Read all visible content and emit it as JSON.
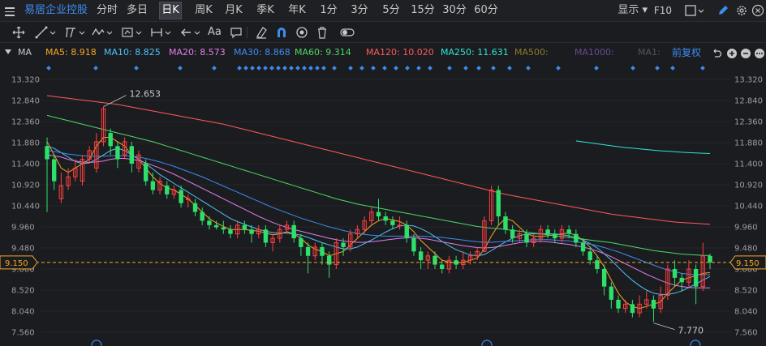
{
  "topbar": {
    "stock_name": "易居企业控股",
    "periods": [
      "分时",
      "多日",
      "日K",
      "周K",
      "月K",
      "季K",
      "年K",
      "1分",
      "3分",
      "5分",
      "15分",
      "30分",
      "60分"
    ],
    "active_period": "日K",
    "display_label": "显示",
    "f10_label": "F10"
  },
  "toolbar": {
    "font_label": "Aa"
  },
  "ma_legend": {
    "label": "MA",
    "items": [
      {
        "text": "MA5: 8.918",
        "color": "#f5a623"
      },
      {
        "text": "MA10: 8.825",
        "color": "#4fc3f7"
      },
      {
        "text": "MA20: 8.573",
        "color": "#e07ee8"
      },
      {
        "text": "MA30: 8.868",
        "color": "#3d8cf0"
      },
      {
        "text": "MA60: 9.314",
        "color": "#4cd964"
      },
      {
        "text": "MA120: 10.020",
        "color": "#ff5a5a"
      },
      {
        "text": "MA250: 11.631",
        "color": "#2ee6d6"
      },
      {
        "text": "MA500:",
        "color": "#8a7a2a"
      },
      {
        "text": "MA1000:",
        "color": "#6a4a8a"
      },
      {
        "text": "MA1:",
        "color": "#555555"
      }
    ],
    "restore_label": "前复权"
  },
  "chart_data": {
    "type": "candlestick",
    "y_ticks": [
      "13.320",
      "12.840",
      "12.360",
      "11.880",
      "11.400",
      "10.920",
      "10.440",
      "9.960",
      "9.480",
      "9.000",
      "8.520",
      "8.040",
      "7.560"
    ],
    "ylim": [
      7.56,
      13.32
    ],
    "current_price": "9.150",
    "high_label": "12.653",
    "low_label": "7.770",
    "up_color": "#ff4040",
    "down_color": "#2ee06a",
    "candles": [
      [
        11.8,
        11.5,
        12.0,
        10.3
      ],
      [
        11.5,
        11.0,
        11.6,
        10.8
      ],
      [
        10.6,
        10.9,
        11.2,
        10.5
      ],
      [
        10.9,
        11.1,
        11.3,
        10.8
      ],
      [
        11.1,
        11.3,
        11.5,
        11.0
      ],
      [
        11.0,
        11.5,
        11.6,
        10.9
      ],
      [
        11.5,
        11.7,
        11.8,
        11.4
      ],
      [
        11.3,
        11.9,
        12.1,
        11.2
      ],
      [
        11.9,
        12.65,
        12.7,
        11.8
      ],
      [
        12.1,
        11.8,
        12.2,
        11.6
      ],
      [
        11.8,
        11.5,
        11.9,
        11.3
      ],
      [
        11.6,
        11.9,
        12.0,
        11.5
      ],
      [
        11.8,
        11.4,
        11.9,
        11.2
      ],
      [
        11.3,
        11.6,
        11.7,
        11.2
      ],
      [
        11.4,
        11.0,
        11.5,
        10.9
      ],
      [
        11.0,
        10.8,
        11.2,
        10.7
      ],
      [
        10.8,
        11.0,
        11.1,
        10.7
      ],
      [
        10.9,
        10.7,
        11.0,
        10.6
      ],
      [
        10.7,
        10.8,
        10.9,
        10.6
      ],
      [
        10.8,
        10.5,
        10.9,
        10.4
      ],
      [
        10.6,
        10.6,
        10.7,
        10.4
      ],
      [
        10.5,
        10.3,
        10.6,
        10.2
      ],
      [
        10.3,
        10.1,
        10.4,
        10.0
      ],
      [
        10.1,
        10.0,
        10.2,
        9.9
      ],
      [
        10.0,
        9.95,
        10.1,
        9.9
      ],
      [
        9.95,
        9.9,
        10.1,
        9.8
      ],
      [
        9.9,
        9.8,
        10.0,
        9.7
      ],
      [
        9.8,
        10.0,
        10.1,
        9.7
      ],
      [
        10.0,
        9.9,
        10.1,
        9.8
      ],
      [
        9.9,
        9.8,
        10.0,
        9.6
      ],
      [
        9.8,
        9.9,
        10.0,
        9.7
      ],
      [
        9.9,
        9.6,
        10.0,
        9.5
      ],
      [
        9.6,
        9.7,
        9.8,
        9.4
      ],
      [
        9.7,
        9.9,
        10.0,
        9.6
      ],
      [
        9.9,
        10.0,
        10.1,
        9.8
      ],
      [
        10.0,
        9.7,
        10.1,
        9.6
      ],
      [
        9.7,
        9.5,
        9.8,
        9.3
      ],
      [
        9.5,
        9.3,
        9.6,
        8.9
      ],
      [
        9.3,
        9.5,
        9.6,
        9.2
      ],
      [
        9.5,
        9.3,
        9.6,
        9.1
      ],
      [
        9.3,
        9.1,
        9.4,
        8.8
      ],
      [
        9.1,
        9.6,
        9.7,
        9.0
      ],
      [
        9.6,
        9.5,
        9.7,
        9.3
      ],
      [
        9.5,
        9.8,
        9.9,
        9.4
      ],
      [
        9.8,
        9.9,
        10.0,
        9.7
      ],
      [
        9.9,
        10.1,
        10.2,
        9.8
      ],
      [
        10.1,
        10.3,
        10.4,
        10.0
      ],
      [
        10.3,
        10.2,
        10.6,
        10.1
      ],
      [
        10.2,
        10.1,
        10.3,
        10.0
      ],
      [
        10.1,
        10.0,
        10.2,
        9.9
      ],
      [
        10.0,
        10.0,
        10.2,
        9.9
      ],
      [
        10.0,
        9.7,
        10.1,
        9.6
      ],
      [
        9.7,
        9.4,
        9.8,
        9.3
      ],
      [
        9.4,
        9.2,
        9.5,
        9.0
      ],
      [
        9.2,
        9.3,
        9.4,
        9.0
      ],
      [
        9.3,
        9.1,
        9.4,
        9.0
      ],
      [
        9.1,
        9.0,
        9.2,
        8.9
      ],
      [
        9.0,
        9.2,
        9.3,
        8.9
      ],
      [
        9.2,
        9.1,
        9.3,
        9.0
      ],
      [
        9.1,
        9.2,
        9.4,
        9.0
      ],
      [
        9.2,
        9.3,
        9.4,
        9.1
      ],
      [
        9.3,
        9.4,
        9.5,
        9.2
      ],
      [
        9.4,
        10.1,
        10.2,
        9.4
      ],
      [
        10.1,
        10.8,
        10.9,
        10.0
      ],
      [
        10.8,
        10.2,
        10.9,
        10.0
      ],
      [
        10.2,
        9.9,
        10.3,
        9.8
      ],
      [
        9.9,
        9.7,
        10.0,
        9.6
      ],
      [
        9.7,
        9.8,
        9.9,
        9.6
      ],
      [
        9.8,
        9.6,
        9.9,
        9.5
      ],
      [
        9.6,
        9.7,
        9.8,
        9.5
      ],
      [
        9.7,
        9.9,
        10.0,
        9.6
      ],
      [
        9.9,
        9.8,
        10.0,
        9.7
      ],
      [
        9.8,
        9.7,
        9.9,
        9.6
      ],
      [
        9.7,
        9.9,
        10.0,
        9.6
      ],
      [
        9.9,
        9.8,
        10.0,
        9.7
      ],
      [
        9.8,
        9.6,
        9.9,
        9.5
      ],
      [
        9.6,
        9.4,
        9.7,
        9.3
      ],
      [
        9.4,
        9.2,
        9.5,
        9.1
      ],
      [
        9.2,
        9.0,
        9.3,
        8.9
      ],
      [
        9.0,
        8.6,
        9.1,
        8.4
      ],
      [
        8.6,
        8.3,
        8.7,
        8.1
      ],
      [
        8.3,
        8.1,
        8.4,
        8.0
      ],
      [
        8.1,
        8.2,
        8.3,
        8.0
      ],
      [
        8.2,
        8.0,
        8.3,
        7.9
      ],
      [
        8.0,
        8.2,
        8.4,
        7.9
      ],
      [
        8.2,
        8.3,
        8.5,
        8.1
      ],
      [
        8.3,
        8.1,
        8.4,
        7.8
      ],
      [
        8.1,
        8.4,
        8.6,
        8.0
      ],
      [
        8.4,
        9.0,
        9.1,
        8.3
      ],
      [
        9.0,
        8.8,
        9.2,
        8.6
      ],
      [
        8.8,
        8.7,
        8.9,
        8.5
      ],
      [
        8.7,
        9.0,
        9.2,
        8.6
      ],
      [
        9.0,
        8.6,
        9.1,
        8.2
      ],
      [
        8.6,
        9.3,
        9.6,
        8.5
      ],
      [
        9.3,
        9.15,
        9.35,
        9.0
      ]
    ],
    "ma_lines": {
      "MA5": [
        11.9,
        11.6,
        11.3,
        11.2,
        11.3,
        11.4,
        11.5,
        11.8,
        12.0,
        12.0,
        11.9,
        11.8,
        11.6,
        11.5,
        11.3,
        11.1,
        10.95,
        10.85,
        10.8,
        10.7,
        10.6,
        10.45,
        10.3,
        10.15,
        10.05,
        9.97,
        9.9,
        9.9,
        9.9,
        9.88,
        9.86,
        9.82,
        9.78,
        9.8,
        9.85,
        9.8,
        9.7,
        9.55,
        9.45,
        9.4,
        9.3,
        9.35,
        9.4,
        9.55,
        9.7,
        9.85,
        10.0,
        10.1,
        10.15,
        10.12,
        10.08,
        10.0,
        9.85,
        9.65,
        9.5,
        9.35,
        9.2,
        9.16,
        9.14,
        9.15,
        9.2,
        9.25,
        9.45,
        9.75,
        10.0,
        10.15,
        10.1,
        9.95,
        9.8,
        9.75,
        9.74,
        9.76,
        9.78,
        9.8,
        9.82,
        9.77,
        9.65,
        9.5,
        9.3,
        9.05,
        8.75,
        8.45,
        8.25,
        8.15,
        8.1,
        8.15,
        8.2,
        8.25,
        8.45,
        8.6,
        8.75,
        8.8,
        8.85,
        8.9,
        8.92
      ],
      "MA10": [
        11.8,
        11.75,
        11.65,
        11.55,
        11.45,
        11.4,
        11.42,
        11.5,
        11.6,
        11.7,
        11.75,
        11.7,
        11.6,
        11.5,
        11.4,
        11.28,
        11.15,
        11.05,
        10.95,
        10.85,
        10.75,
        10.65,
        10.55,
        10.45,
        10.35,
        10.25,
        10.15,
        10.08,
        10.02,
        9.96,
        9.9,
        9.86,
        9.83,
        9.82,
        9.82,
        9.8,
        9.77,
        9.72,
        9.66,
        9.6,
        9.55,
        9.5,
        9.46,
        9.46,
        9.5,
        9.58,
        9.66,
        9.75,
        9.84,
        9.92,
        9.98,
        10.0,
        9.98,
        9.92,
        9.84,
        9.74,
        9.63,
        9.53,
        9.44,
        9.38,
        9.32,
        9.3,
        9.33,
        9.42,
        9.52,
        9.62,
        9.7,
        9.76,
        9.8,
        9.8,
        9.8,
        9.8,
        9.8,
        9.78,
        9.76,
        9.72,
        9.66,
        9.58,
        9.48,
        9.35,
        9.2,
        9.04,
        8.88,
        8.74,
        8.62,
        8.52,
        8.45,
        8.42,
        8.42,
        8.45,
        8.5,
        8.58,
        8.66,
        8.75,
        8.83
      ],
      "MA20": [
        11.6,
        11.58,
        11.55,
        11.5,
        11.46,
        11.44,
        11.43,
        11.44,
        11.46,
        11.5,
        11.52,
        11.52,
        11.5,
        11.47,
        11.42,
        11.36,
        11.3,
        11.23,
        11.16,
        11.08,
        11.0,
        10.92,
        10.84,
        10.76,
        10.68,
        10.6,
        10.52,
        10.44,
        10.36,
        10.28,
        10.2,
        10.13,
        10.06,
        10.0,
        9.95,
        9.9,
        9.86,
        9.82,
        9.78,
        9.74,
        9.7,
        9.67,
        9.64,
        9.62,
        9.61,
        9.61,
        9.62,
        9.64,
        9.66,
        9.68,
        9.7,
        9.71,
        9.71,
        9.7,
        9.68,
        9.65,
        9.62,
        9.59,
        9.56,
        9.53,
        9.51,
        9.49,
        9.48,
        9.49,
        9.51,
        9.54,
        9.57,
        9.6,
        9.62,
        9.63,
        9.63,
        9.62,
        9.6,
        9.58,
        9.56,
        9.53,
        9.5,
        9.46,
        9.41,
        9.35,
        9.28,
        9.2,
        9.12,
        9.04,
        8.96,
        8.88,
        8.81,
        8.74,
        8.68,
        8.63,
        8.6,
        8.58,
        8.57,
        8.57,
        8.57
      ],
      "MA30": [
        11.7,
        11.68,
        11.65,
        11.62,
        11.6,
        11.58,
        11.57,
        11.57,
        11.57,
        11.58,
        11.58,
        11.58,
        11.57,
        11.55,
        11.52,
        11.48,
        11.44,
        11.39,
        11.34,
        11.28,
        11.22,
        11.16,
        11.1,
        11.03,
        10.96,
        10.89,
        10.82,
        10.75,
        10.68,
        10.61,
        10.54,
        10.47,
        10.4,
        10.34,
        10.28,
        10.22,
        10.16,
        10.11,
        10.06,
        10.01,
        9.96,
        9.92,
        9.88,
        9.84,
        9.81,
        9.79,
        9.77,
        9.76,
        9.75,
        9.75,
        9.75,
        9.75,
        9.75,
        9.75,
        9.74,
        9.73,
        9.72,
        9.7,
        9.68,
        9.66,
        9.64,
        9.62,
        9.61,
        9.61,
        9.62,
        9.63,
        9.64,
        9.65,
        9.66,
        9.67,
        9.67,
        9.67,
        9.66,
        9.65,
        9.64,
        9.62,
        9.6,
        9.57,
        9.53,
        9.49,
        9.44,
        9.39,
        9.33,
        9.27,
        9.21,
        9.15,
        9.09,
        9.03,
        8.98,
        8.94,
        8.9,
        8.88,
        8.87,
        8.87,
        8.87
      ],
      "MA60": [
        12.5,
        12.46,
        12.42,
        12.38,
        12.34,
        12.3,
        12.26,
        12.22,
        12.18,
        12.14,
        12.1,
        12.06,
        12.02,
        11.98,
        11.94,
        11.9,
        11.85,
        11.8,
        11.75,
        11.7,
        11.65,
        11.6,
        11.55,
        11.5,
        11.45,
        11.4,
        11.35,
        11.3,
        11.25,
        11.2,
        11.15,
        11.1,
        11.05,
        11.0,
        10.95,
        10.9,
        10.85,
        10.8,
        10.75,
        10.7,
        10.65,
        10.6,
        10.56,
        10.52,
        10.48,
        10.45,
        10.42,
        10.39,
        10.36,
        10.33,
        10.3,
        10.27,
        10.24,
        10.21,
        10.18,
        10.15,
        10.12,
        10.09,
        10.06,
        10.03,
        10.0,
        9.97,
        9.95,
        9.93,
        9.92,
        9.9,
        9.88,
        9.86,
        9.84,
        9.82,
        9.8,
        9.78,
        9.76,
        9.74,
        9.72,
        9.7,
        9.68,
        9.66,
        9.64,
        9.62,
        9.6,
        9.57,
        9.54,
        9.51,
        9.48,
        9.45,
        9.42,
        9.4,
        9.38,
        9.36,
        9.34,
        9.33,
        9.32,
        9.31,
        9.31
      ],
      "MA120": [
        12.95,
        12.93,
        12.91,
        12.89,
        12.87,
        12.85,
        12.83,
        12.81,
        12.79,
        12.77,
        12.75,
        12.72,
        12.69,
        12.66,
        12.63,
        12.6,
        12.57,
        12.54,
        12.51,
        12.48,
        12.45,
        12.42,
        12.39,
        12.36,
        12.33,
        12.3,
        12.26,
        12.22,
        12.18,
        12.14,
        12.1,
        12.06,
        12.02,
        11.98,
        11.94,
        11.9,
        11.86,
        11.82,
        11.78,
        11.74,
        11.7,
        11.66,
        11.62,
        11.58,
        11.54,
        11.5,
        11.46,
        11.42,
        11.38,
        11.34,
        11.3,
        11.26,
        11.22,
        11.18,
        11.14,
        11.1,
        11.06,
        11.02,
        10.98,
        10.94,
        10.9,
        10.86,
        10.82,
        10.78,
        10.74,
        10.7,
        10.67,
        10.64,
        10.61,
        10.58,
        10.55,
        10.52,
        10.49,
        10.46,
        10.43,
        10.4,
        10.37,
        10.34,
        10.31,
        10.28,
        10.25,
        10.23,
        10.21,
        10.19,
        10.17,
        10.15,
        10.13,
        10.11,
        10.09,
        10.07,
        10.06,
        10.05,
        10.04,
        10.03,
        10.02
      ],
      "MA250_segment": [
        11.92,
        11.89,
        11.86,
        11.83,
        11.8,
        11.77,
        11.75,
        11.73,
        11.71,
        11.69,
        11.68,
        11.66,
        11.65,
        11.64,
        11.63
      ]
    }
  }
}
